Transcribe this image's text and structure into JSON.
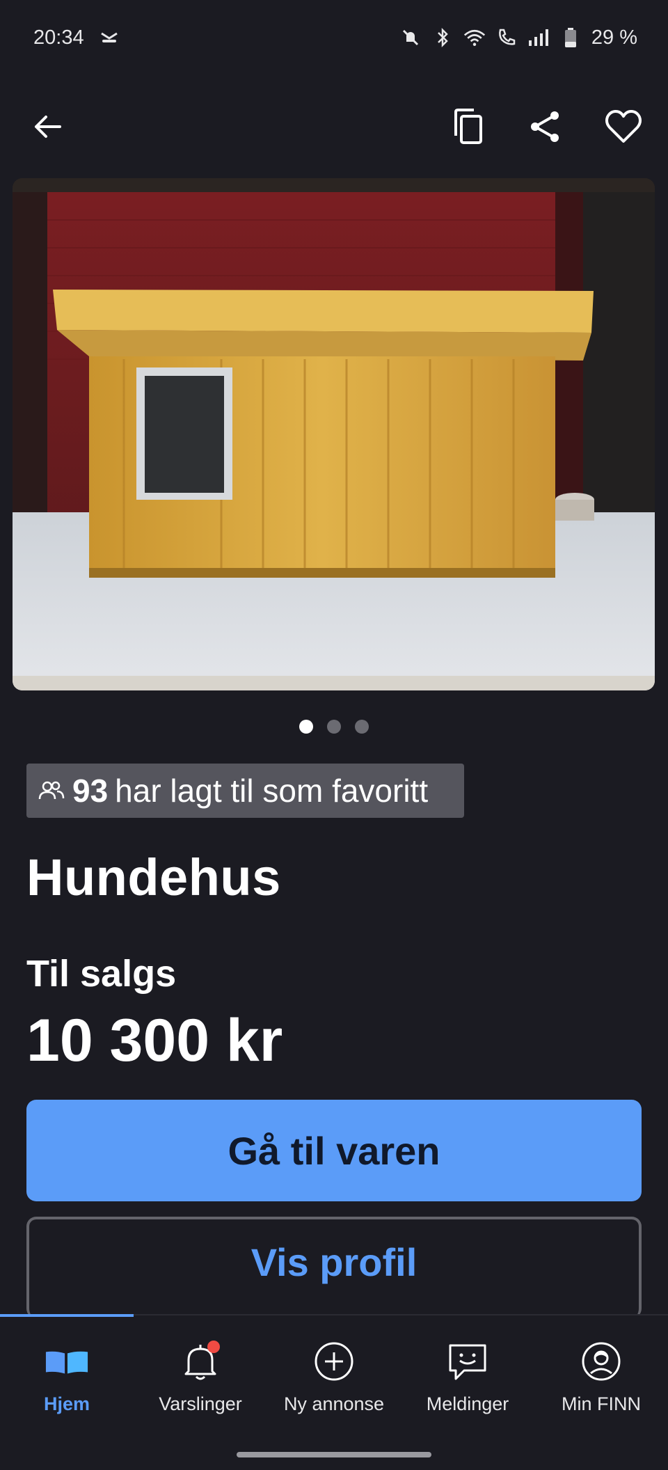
{
  "status_bar": {
    "time": "20:34",
    "battery": "29 %"
  },
  "listing": {
    "favorites_count": "93",
    "favorites_text": "har lagt til som favoritt",
    "title": "Hundehus",
    "sale_type": "Til salgs",
    "price": "10 300 kr",
    "image_count": 3,
    "image_index": 1
  },
  "actions": {
    "primary_label": "Gå til varen",
    "secondary_label": "Vis profil"
  },
  "bottom_nav": {
    "items": [
      {
        "label": "Hjem",
        "icon": "home-icon",
        "active": true
      },
      {
        "label": "Varslinger",
        "icon": "bell-icon",
        "badge": true
      },
      {
        "label": "Ny annonse",
        "icon": "plus-circle-icon"
      },
      {
        "label": "Meldinger",
        "icon": "chat-icon"
      },
      {
        "label": "Min FINN",
        "icon": "profile-icon"
      }
    ]
  },
  "colors": {
    "background": "#1b1b22",
    "accent": "#5b9cf8",
    "badge_bg": "#55555d",
    "notification": "#ef4b43"
  }
}
